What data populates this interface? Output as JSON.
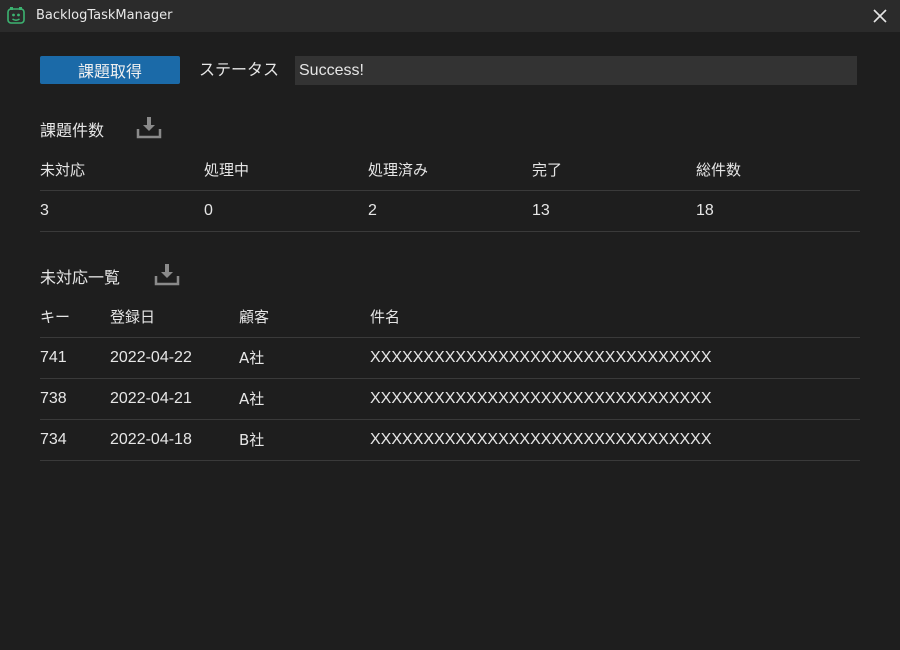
{
  "window": {
    "title": "BacklogTaskManager"
  },
  "toolbar": {
    "fetch_button_label": "課題取得",
    "status_label": "ステータス",
    "status_value": "Success!"
  },
  "counts_section": {
    "title": "課題件数",
    "headers": [
      "未対応",
      "処理中",
      "処理済み",
      "完了",
      "総件数"
    ],
    "values": [
      "3",
      "0",
      "2",
      "13",
      "18"
    ]
  },
  "open_list_section": {
    "title": "未対応一覧",
    "headers": [
      "キー",
      "登録日",
      "顧客",
      "件名"
    ],
    "rows": [
      [
        "741",
        "2022-04-22",
        "A社",
        "XXXXXXXXXXXXXXXXXXXXXXXXXXXXXXXX"
      ],
      [
        "738",
        "2022-04-21",
        "A社",
        "XXXXXXXXXXXXXXXXXXXXXXXXXXXXXXXX"
      ],
      [
        "734",
        "2022-04-18",
        "B社",
        "XXXXXXXXXXXXXXXXXXXXXXXXXXXXXXXX"
      ]
    ]
  },
  "icons": {
    "app": "app-logo-icon",
    "close": "close-icon",
    "download": "download-icon"
  },
  "colors": {
    "background": "#1e1e1e",
    "titlebar": "#2b2b2b",
    "accent": "#1b6aa8",
    "field_background": "#333333",
    "divider": "#3a3a3a",
    "app_icon_green": "#3cb371"
  }
}
